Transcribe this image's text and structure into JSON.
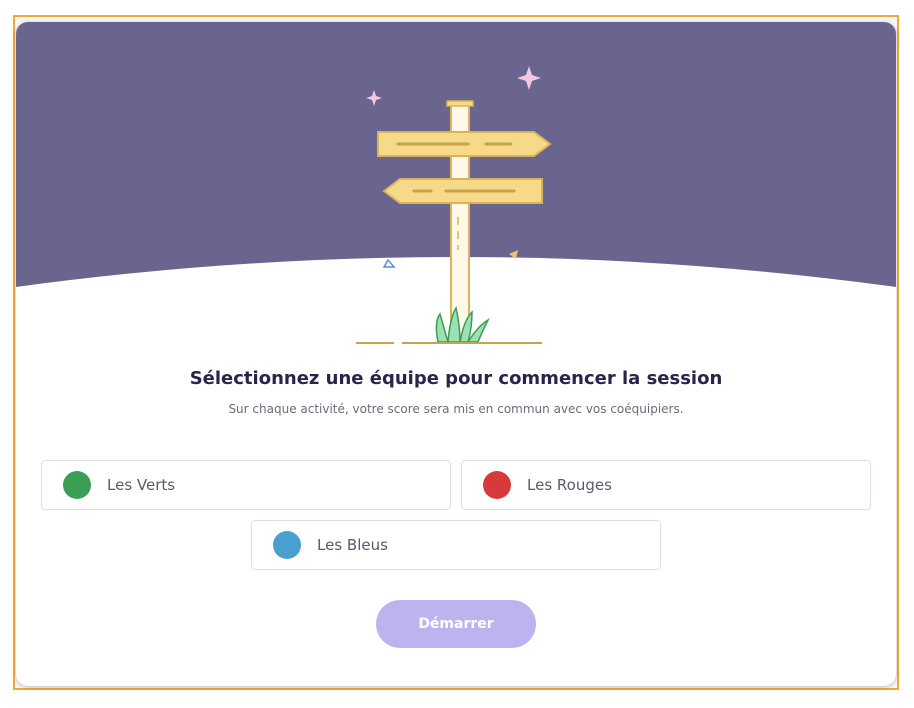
{
  "colors": {
    "frame_border": "#f2a93b",
    "hero_background": "#6a658f",
    "sign_fill": "#f7d98a",
    "title_text": "#27254a",
    "start_button": "#bbb4ee"
  },
  "heading": {
    "title": "Sélectionnez une équipe pour commencer la session",
    "subtitle": "Sur chaque activité, votre score sera mis en commun avec vos coéquipiers."
  },
  "teams": [
    {
      "label": "Les Verts",
      "color": "#3a9e55"
    },
    {
      "label": "Les Rouges",
      "color": "#d8393b"
    },
    {
      "label": "Les Bleus",
      "color": "#4a9fd1"
    }
  ],
  "actions": {
    "start_label": "Démarrer",
    "start_state": "disabled"
  }
}
